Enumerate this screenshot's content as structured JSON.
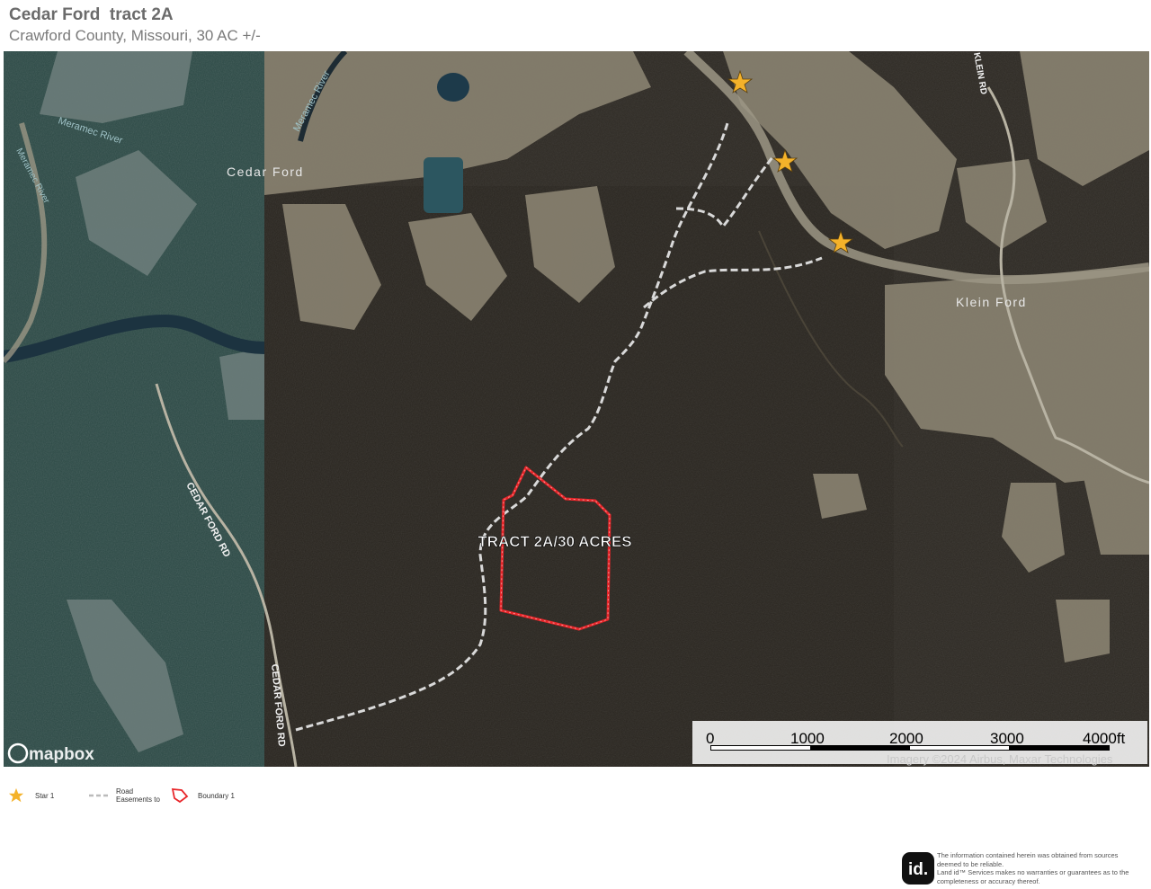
{
  "header": {
    "title": "Cedar Ford  tract 2A",
    "subtitle": "Crawford County, Missouri, 30 AC +/-"
  },
  "map": {
    "labels": {
      "cedar_ford": "Cedar Ford",
      "klein_ford": "Klein Ford",
      "meramec_river": "Meramec River",
      "cedar_ford_rd": "CEDAR FORD RD",
      "klein_rd": "KLEIN RD",
      "tract": "TRACT 2A/30 ACRES"
    },
    "colors": {
      "boundary": "#e8262a",
      "star": "#f4b22a",
      "easement": "#d9d9d9"
    },
    "attribution": "Imagery ©2024 Airbus, Maxar Technologies",
    "mapbox_logo": "mapbox"
  },
  "scale_bar": {
    "ticks": [
      "0",
      "1000",
      "2000",
      "3000",
      "4000ft"
    ]
  },
  "legend": {
    "star": "Star 1",
    "road_line1": "Road",
    "road_line2": "Easements to",
    "boundary": "Boundary 1"
  },
  "footer": {
    "logo_text": "id.",
    "disclaimer_line1": "The information contained herein was obtained from sources",
    "disclaimer_line2": "deemed to be reliable.",
    "disclaimer_line3": "Land id™ Services makes no warranties or guarantees as to the",
    "disclaimer_line4": "completeness or accuracy thereof."
  }
}
